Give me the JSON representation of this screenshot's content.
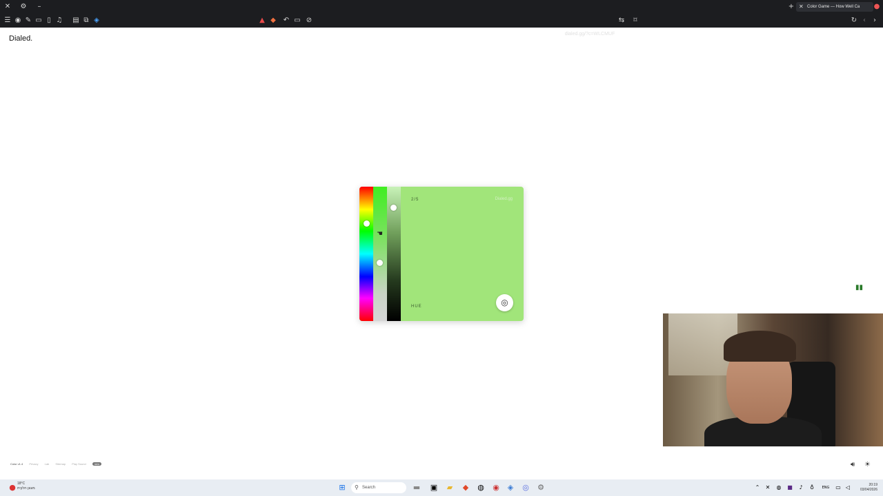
{
  "browser": {
    "tab_title": "Color Game — How Well Ca",
    "url": "dialed.gg/?c=WLCMUF"
  },
  "page": {
    "brand": "Dialed."
  },
  "picker": {
    "progress": "2/5",
    "watermark": "Dialed.gg",
    "mode_label": "HUE",
    "current_color": "#a1e57a"
  },
  "footer": {
    "items": [
      "Color v1.4",
      "Privacy",
      "Lab",
      "Sitemap",
      "Play Sound"
    ],
    "badge": "new"
  },
  "taskbar": {
    "search_placeholder": "Search",
    "weather_temp": "18°C",
    "weather_desc": "מעונן חלקית",
    "time": "20:19",
    "date": "03/04/2026",
    "lang": "ENG"
  }
}
